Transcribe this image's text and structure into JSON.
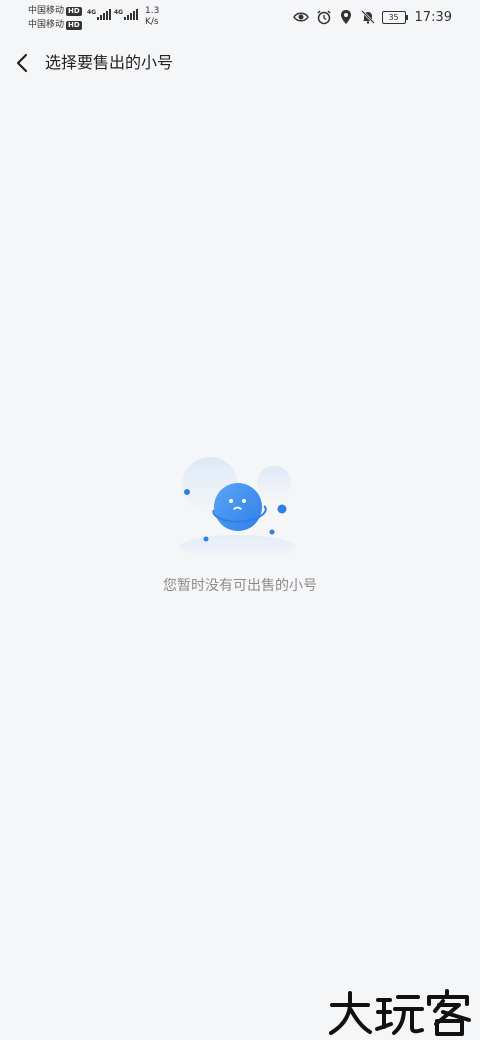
{
  "status_bar": {
    "carrier_1": "中国移动",
    "carrier_2": "中国移动",
    "hd_label": "HD",
    "network_1": "4G",
    "network_2": "4G",
    "speed_value": "1.3",
    "speed_unit": "K/s",
    "battery": "35",
    "time": "17:39",
    "icons": [
      "eye-icon",
      "alarm-icon",
      "location-icon",
      "bell-mute-icon",
      "battery-icon"
    ]
  },
  "nav": {
    "title": "选择要售出的小号",
    "back_icon": "chevron-left-icon"
  },
  "empty_state": {
    "illustration": "planet-illustration",
    "message": "您暂时没有可出售的小号"
  },
  "watermark": {
    "text": "大玩客"
  },
  "colors": {
    "background": "#f5f6f8",
    "planet": "#3a8ff0",
    "planet_light": "#dde9f7",
    "empty_text": "#8c8c8c"
  }
}
